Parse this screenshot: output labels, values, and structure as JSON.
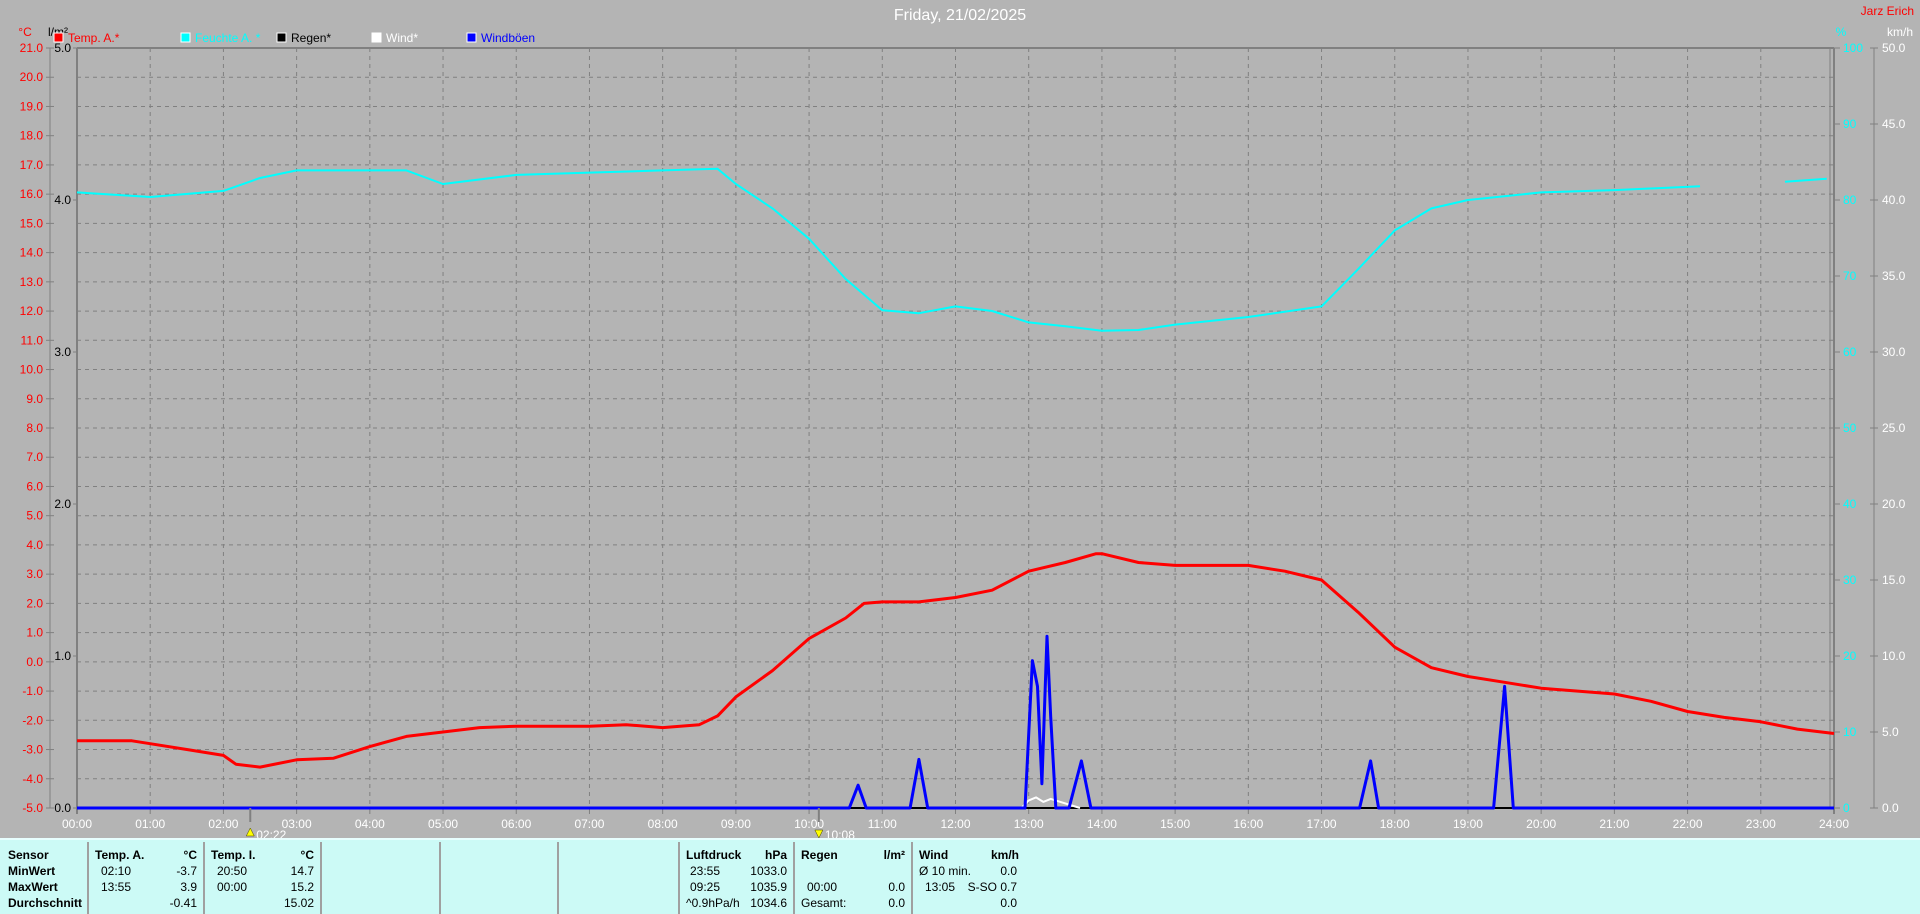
{
  "title": "Friday, 21/02/2025",
  "author": "Jarz Erich",
  "colors": {
    "temp": "#ff0000",
    "humidity": "#00ffff",
    "rain": "#000000",
    "wind": "#ffffff",
    "gusts": "#0000ff",
    "background": "#b4b4b4",
    "table": "#ccfaf6"
  },
  "legend": [
    {
      "label": "Temp. A.*",
      "color": "#ff0000"
    },
    {
      "label": "Feuchte A. *",
      "color": "#00ffff"
    },
    {
      "label": "Regen*",
      "color": "#000000"
    },
    {
      "label": "Wind*",
      "color": "#ffffff"
    },
    {
      "label": "Windböen",
      "color": "#0000ff"
    }
  ],
  "markers": [
    {
      "time": "02:22",
      "direction": "up"
    },
    {
      "time": "10:08",
      "direction": "down"
    }
  ],
  "chart_data": {
    "type": "line",
    "title": "Friday, 21/02/2025",
    "x_ticks": [
      "00:00",
      "01:00",
      "02:00",
      "03:00",
      "04:00",
      "05:00",
      "06:00",
      "07:00",
      "08:00",
      "09:00",
      "10:00",
      "11:00",
      "12:00",
      "13:00",
      "14:00",
      "15:00",
      "16:00",
      "17:00",
      "18:00",
      "19:00",
      "20:00",
      "21:00",
      "22:00",
      "23:00",
      "24:00"
    ],
    "xlim": [
      0,
      24
    ],
    "grid": true,
    "legend_position": "top-left",
    "axes": {
      "temp": {
        "unit": "°C",
        "range": [
          -5,
          21
        ],
        "ticks": [
          "21.0",
          "20.0",
          "19.0",
          "18.0",
          "17.0",
          "16.0",
          "15.0",
          "14.0",
          "13.0",
          "12.0",
          "11.0",
          "10.0",
          "9.0",
          "8.0",
          "7.0",
          "6.0",
          "5.0",
          "4.0",
          "3.0",
          "2.0",
          "1.0",
          "0.0",
          "-1.0",
          "-2.0",
          "-3.0",
          "-4.0",
          "-5.0"
        ]
      },
      "rain": {
        "unit": "l/m²",
        "range": [
          0,
          5
        ],
        "ticks": [
          "5.0",
          "4.0",
          "3.0",
          "2.0",
          "1.0",
          "0.0"
        ]
      },
      "humidity": {
        "unit": "%",
        "range": [
          0,
          100
        ],
        "ticks": [
          "100",
          "90",
          "80",
          "70",
          "60",
          "50",
          "40",
          "30",
          "20",
          "10",
          "0"
        ]
      },
      "wind": {
        "unit": "km/h",
        "range": [
          0,
          50
        ],
        "ticks": [
          "50.0",
          "45.0",
          "40.0",
          "35.0",
          "30.0",
          "25.0",
          "20.0",
          "15.0",
          "10.0",
          "5.0",
          "0.0"
        ]
      }
    },
    "series": [
      {
        "name": "Temp. A.*",
        "axis": "temp",
        "color": "#ff0000",
        "x": [
          0,
          0.75,
          1,
          1.5,
          2,
          2.17,
          2.5,
          3,
          3.5,
          4,
          4.5,
          5,
          5.5,
          6,
          7,
          7.5,
          8,
          8.5,
          8.75,
          9,
          9.5,
          10,
          10.5,
          10.75,
          11,
          11.5,
          12,
          12.5,
          13,
          13.5,
          13.92,
          14,
          14.5,
          15,
          16,
          16.5,
          17,
          17.5,
          18,
          18.5,
          19,
          19.5,
          20,
          21,
          21.5,
          22,
          22.5,
          23,
          23.5,
          24
        ],
        "y": [
          -2.7,
          -2.7,
          -2.8,
          -3.0,
          -3.2,
          -3.5,
          -3.6,
          -3.35,
          -3.3,
          -2.9,
          -2.55,
          -2.4,
          -2.25,
          -2.2,
          -2.2,
          -2.15,
          -2.25,
          -2.15,
          -1.85,
          -1.2,
          -0.3,
          0.8,
          1.5,
          2.0,
          2.05,
          2.05,
          2.2,
          2.45,
          3.1,
          3.4,
          3.7,
          3.7,
          3.4,
          3.3,
          3.3,
          3.1,
          2.8,
          1.7,
          0.5,
          -0.2,
          -0.5,
          -0.7,
          -0.9,
          -1.1,
          -1.35,
          -1.7,
          -1.9,
          -2.05,
          -2.3,
          -2.45
        ]
      },
      {
        "name": "Feuchte A. *",
        "axis": "humidity",
        "color": "#00ffff",
        "x": [
          0,
          1,
          2,
          2.5,
          3,
          4,
          4.5,
          5,
          6,
          7,
          8,
          8.75,
          9,
          9.5,
          10,
          10.5,
          11,
          11.5,
          12,
          12.5,
          13,
          13.5,
          14,
          14.5,
          15,
          16,
          17,
          17.5,
          18,
          18.5,
          19,
          20,
          21,
          22.17,
          null,
          23.33,
          23.9
        ],
        "y": [
          81.0,
          80.4,
          81.2,
          82.9,
          83.9,
          83.9,
          83.9,
          82.1,
          83.3,
          83.6,
          83.9,
          84.1,
          82.1,
          78.9,
          74.9,
          69.6,
          65.5,
          65.1,
          66.0,
          65.4,
          63.9,
          63.4,
          62.8,
          62.9,
          63.6,
          64.6,
          66.0,
          70.9,
          76.0,
          78.9,
          80.0,
          81.0,
          81.3,
          81.8,
          null,
          82.4,
          82.8
        ]
      },
      {
        "name": "Regen*",
        "axis": "rain",
        "color": "#000000",
        "x": [
          0,
          24
        ],
        "y": [
          0,
          0
        ]
      },
      {
        "name": "Wind*",
        "axis": "wind",
        "color": "#ffffff",
        "x": [
          12.9,
          13.0,
          13.1,
          13.2,
          13.3,
          13.5,
          13.7
        ],
        "y": [
          0,
          0.5,
          0.7,
          0.4,
          0.6,
          0.3,
          0
        ]
      },
      {
        "name": "Windböen",
        "axis": "wind",
        "color": "#0000ff",
        "x": [
          0,
          10.55,
          10.67,
          10.78,
          11.38,
          11.5,
          11.62,
          12.95,
          13.05,
          13.12,
          13.18,
          13.25,
          13.3,
          13.37,
          13.55,
          13.72,
          13.85,
          17.52,
          17.67,
          17.78,
          19.35,
          19.5,
          19.62,
          24
        ],
        "y": [
          0,
          0,
          1.5,
          0,
          0,
          3.2,
          0,
          0,
          9.7,
          8.0,
          1.6,
          11.3,
          6,
          0,
          0,
          3.1,
          0,
          0,
          3.1,
          0,
          0,
          8.0,
          0,
          0
        ]
      }
    ]
  },
  "table": {
    "sensor": {
      "header": "Sensor",
      "rows": [
        "MinWert",
        "MaxWert",
        "Durchschnitt"
      ]
    },
    "temp_a": {
      "header": "Temp. A.",
      "unit": "°C",
      "rows": [
        [
          "02:10",
          "-3.7"
        ],
        [
          "13:55",
          "3.9"
        ],
        [
          "",
          "-0.41"
        ]
      ]
    },
    "temp_i": {
      "header": "Temp. I.",
      "unit": "°C",
      "rows": [
        [
          "20:50",
          "14.7"
        ],
        [
          "00:00",
          "15.2"
        ],
        [
          "",
          "15.02"
        ]
      ]
    },
    "pressure": {
      "header": "Luftdruck",
      "unit": "hPa",
      "rows": [
        [
          "23:55",
          "1033.0"
        ],
        [
          "09:25",
          "1035.9"
        ],
        [
          "^0.9hPa/h",
          "1034.6"
        ]
      ]
    },
    "rain": {
      "header": "Regen",
      "unit": "l/m²",
      "rows": [
        [
          "",
          ""
        ],
        [
          "00:00",
          "0.0"
        ],
        [
          "Gesamt:",
          "0.0"
        ]
      ]
    },
    "wind": {
      "header": "Wind",
      "unit": "km/h",
      "rows": [
        [
          "Ø 10 min.",
          "0.0"
        ],
        [
          "13:05",
          "S-SO 0.7"
        ],
        [
          "",
          "0.0"
        ]
      ]
    }
  }
}
